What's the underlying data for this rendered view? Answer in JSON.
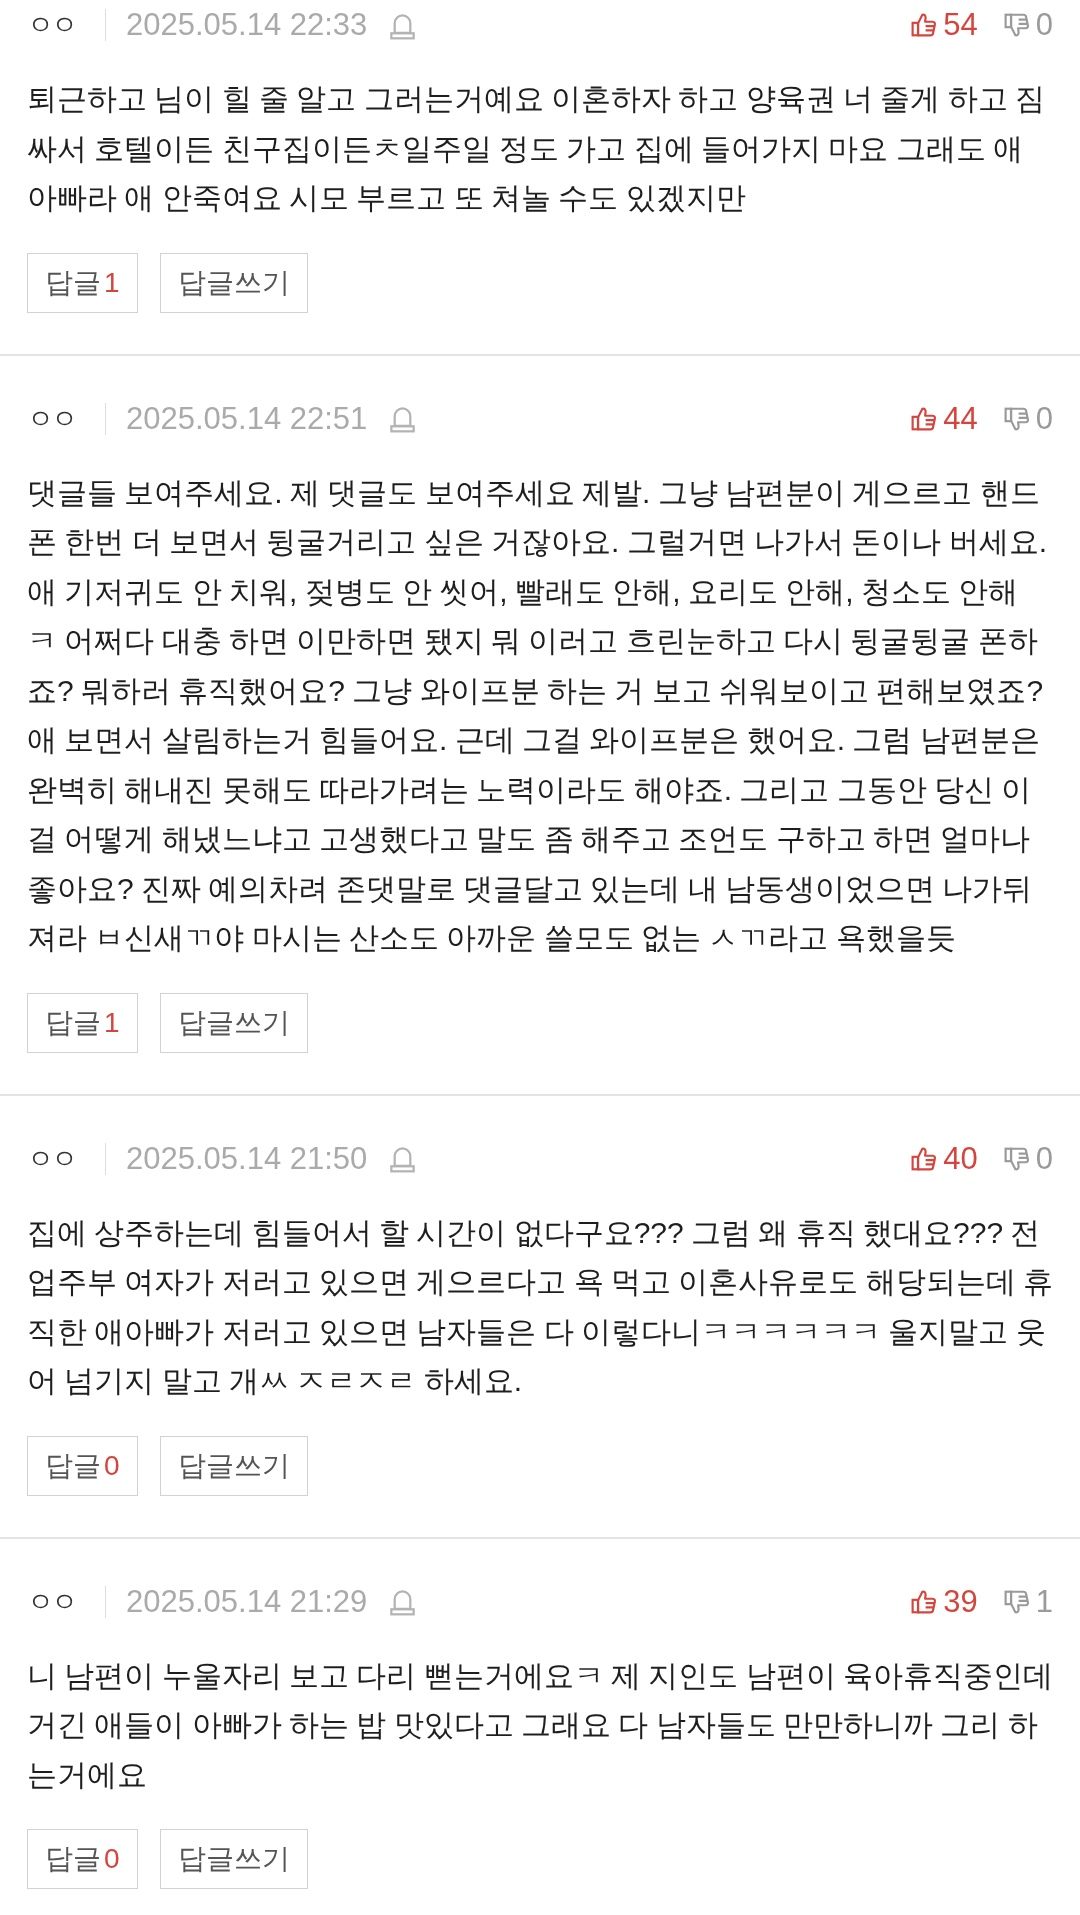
{
  "comments": [
    {
      "author": "ㅇㅇ",
      "date": "2025.05.14 22:33",
      "likes": "54",
      "dislikes": "0",
      "text": "퇴근하고 님이 힐 줄 알고 그러는거예요 이혼하자 하고 양육권 너 줄게 하고 짐 싸서 호텔이든 친구집이든ㅊ일주일 정도 가고 집에 들어가지 마요 그래도 애 아빠라 애 안죽여요 시모 부르고 또 쳐놀 수도 있겠지만",
      "reply_label": "답글",
      "reply_count": "1",
      "write_reply_label": "답글쓰기"
    },
    {
      "author": "ㅇㅇ",
      "date": "2025.05.14 22:51",
      "likes": "44",
      "dislikes": "0",
      "text": "댓글들 보여주세요. 제 댓글도 보여주세요 제발. 그냥 남편분이 게으르고 핸드폰 한번 더 보면서 뒹굴거리고 싶은 거잖아요. 그럴거면 나가서 돈이나 버세요. 애 기저귀도 안 치워, 젖병도 안 씻어, 빨래도 안해, 요리도 안해, 청소도 안해 ㅋ 어쩌다 대충 하면 이만하면 됐지 뭐 이러고 흐린눈하고 다시 뒹굴뒹굴 폰하죠? 뭐하러 휴직했어요? 그냥 와이프분 하는 거 보고 쉬워보이고 편해보였죠? 애 보면서 살림하는거 힘들어요. 근데 그걸 와이프분은 했어요. 그럼 남편분은 완벽히 해내진 못해도 따라가려는 노력이라도 해야죠. 그리고 그동안 당신 이걸 어떻게 해냈느냐고 고생했다고 말도 좀 해주고 조언도 구하고 하면 얼마나 좋아요? 진짜 예의차려 존댓말로 댓글달고 있는데 내 남동생이었으면 나가뒤져라 ㅂ신새ㄲ야 마시는 산소도 아까운 쓸모도 없는 ㅅㄲ라고 욕했을듯",
      "reply_label": "답글",
      "reply_count": "1",
      "write_reply_label": "답글쓰기"
    },
    {
      "author": "ㅇㅇ",
      "date": "2025.05.14 21:50",
      "likes": "40",
      "dislikes": "0",
      "text": "집에 상주하는데 힘들어서 할 시간이 없다구요??? 그럼 왜 휴직 했대요??? 전업주부 여자가 저러고 있으면 게으르다고 욕 먹고 이혼사유로도 해당되는데 휴직한 애아빠가 저러고 있으면 남자들은 다 이렇다니ㅋㅋㅋㅋㅋㅋ 울지말고 웃어 넘기지 말고 개ㅆ ㅈㄹㅈㄹ 하세요.",
      "reply_label": "답글",
      "reply_count": "0",
      "write_reply_label": "답글쓰기"
    },
    {
      "author": "ㅇㅇ",
      "date": "2025.05.14 21:29",
      "likes": "39",
      "dislikes": "1",
      "text": "니 남편이 누울자리 보고 다리 뻗는거에요ㅋ 제 지인도 남편이 육아휴직중인데 거긴 애들이 아빠가 하는 밥 맛있다고 그래요 다 남자들도 만만하니까 그리 하는거에요",
      "reply_label": "답글",
      "reply_count": "0",
      "write_reply_label": "답글쓰기"
    }
  ]
}
